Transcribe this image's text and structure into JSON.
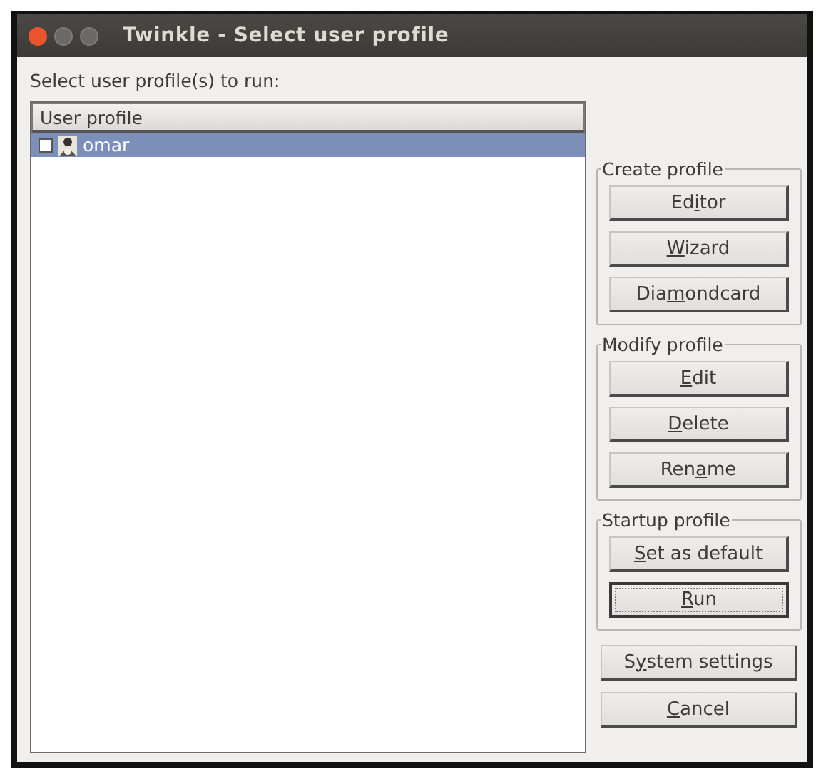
{
  "window": {
    "title": "Twinkle - Select user profile"
  },
  "prompt": "Select user profile(s) to run:",
  "profile_list": {
    "column": "User profile",
    "rows": [
      {
        "name": "omar",
        "checked": false,
        "selected": true
      }
    ]
  },
  "groups": [
    {
      "title": "Create profile",
      "buttons": [
        {
          "before": "Ed",
          "mnemonic": "i",
          "after": "tor",
          "focused": false
        },
        {
          "mnemonic": "W",
          "after": "izard",
          "focused": false
        },
        {
          "before": "Dia",
          "mnemonic": "m",
          "after": "ondcard",
          "focused": false
        }
      ]
    },
    {
      "title": "Modify profile",
      "buttons": [
        {
          "mnemonic": "E",
          "after": "dit",
          "focused": false
        },
        {
          "mnemonic": "D",
          "after": "elete",
          "focused": false
        },
        {
          "before": "Ren",
          "mnemonic": "a",
          "after": "me",
          "focused": false
        }
      ]
    },
    {
      "title": "Startup profile",
      "buttons": [
        {
          "mnemonic": "S",
          "after": "et as default",
          "focused": false
        },
        {
          "mnemonic": "R",
          "after": "un",
          "focused": true
        }
      ]
    }
  ],
  "buttons": [
    {
      "before": "S",
      "mnemonic": "y",
      "after": "stem settings",
      "focused": false
    },
    {
      "mnemonic": "C",
      "after": "ancel",
      "focused": false
    }
  ]
}
